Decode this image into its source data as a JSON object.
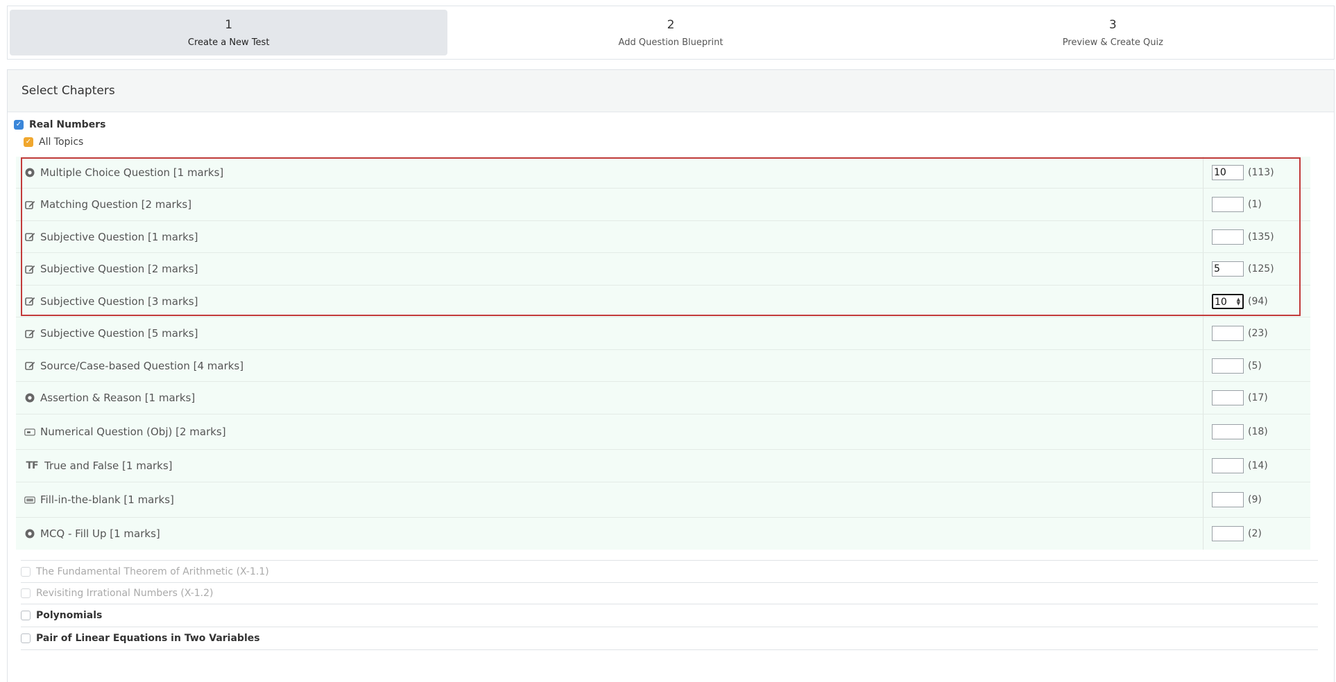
{
  "stepper": {
    "steps": [
      {
        "num": "1",
        "label": "Create a New Test"
      },
      {
        "num": "2",
        "label": "Add Question Blueprint"
      },
      {
        "num": "3",
        "label": "Preview & Create Quiz"
      }
    ]
  },
  "panel": {
    "title": "Select Chapters"
  },
  "chapter": {
    "name": "Real Numbers",
    "all_topics": "All Topics"
  },
  "questions": [
    {
      "label": "Multiple Choice Question [1 marks]",
      "value": "10",
      "count": "(113)",
      "icon": "radio-circle-icon"
    },
    {
      "label": "Matching Question [2 marks]",
      "value": "",
      "count": "(1)",
      "icon": "edit-icon"
    },
    {
      "label": "Subjective Question [1 marks]",
      "value": "",
      "count": "(135)",
      "icon": "edit-icon"
    },
    {
      "label": "Subjective Question [2 marks]",
      "value": "5",
      "count": "(125)",
      "icon": "edit-icon"
    },
    {
      "label": "Subjective Question [3 marks]",
      "value": "10",
      "count": "(94)",
      "icon": "edit-icon"
    },
    {
      "label": "Subjective Question [5 marks]",
      "value": "",
      "count": "(23)",
      "icon": "edit-icon"
    },
    {
      "label": "Source/Case-based Question [4 marks]",
      "value": "",
      "count": "(5)",
      "icon": "edit-icon"
    },
    {
      "label": "Assertion & Reason [1 marks]",
      "value": "",
      "count": "(17)",
      "icon": "radio-circle-icon"
    },
    {
      "label": "Numerical Question (Obj) [2 marks]",
      "value": "",
      "count": "(18)",
      "icon": "numeric-box-icon"
    },
    {
      "label": "True and False [1 marks]",
      "value": "",
      "count": "(14)",
      "icon": "true-false-icon"
    },
    {
      "label": "Fill-in-the-blank [1 marks]",
      "value": "",
      "count": "(9)",
      "icon": "fill-blank-icon"
    },
    {
      "label": "MCQ - Fill Up [1 marks]",
      "value": "",
      "count": "(2)",
      "icon": "radio-circle-icon"
    }
  ],
  "topics": [
    {
      "label": "The Fundamental Theorem of Arithmetic (X-1.1)"
    },
    {
      "label": "Revisiting Irrational Numbers (X-1.2)"
    }
  ],
  "other_chapters": [
    {
      "label": "Polynomials"
    },
    {
      "label": "Pair of Linear Equations in Two Variables"
    }
  ],
  "icons": {
    "tf_glyph": "TF",
    "check_glyph": "✓",
    "spin_up": "▲",
    "spin_down": "▼"
  },
  "colors": {
    "checkbox_blue": "#3a86d9",
    "checkbox_orange": "#f0a72e",
    "highlight_red": "#c23a3a",
    "row_bg": "#f3fcf7"
  }
}
